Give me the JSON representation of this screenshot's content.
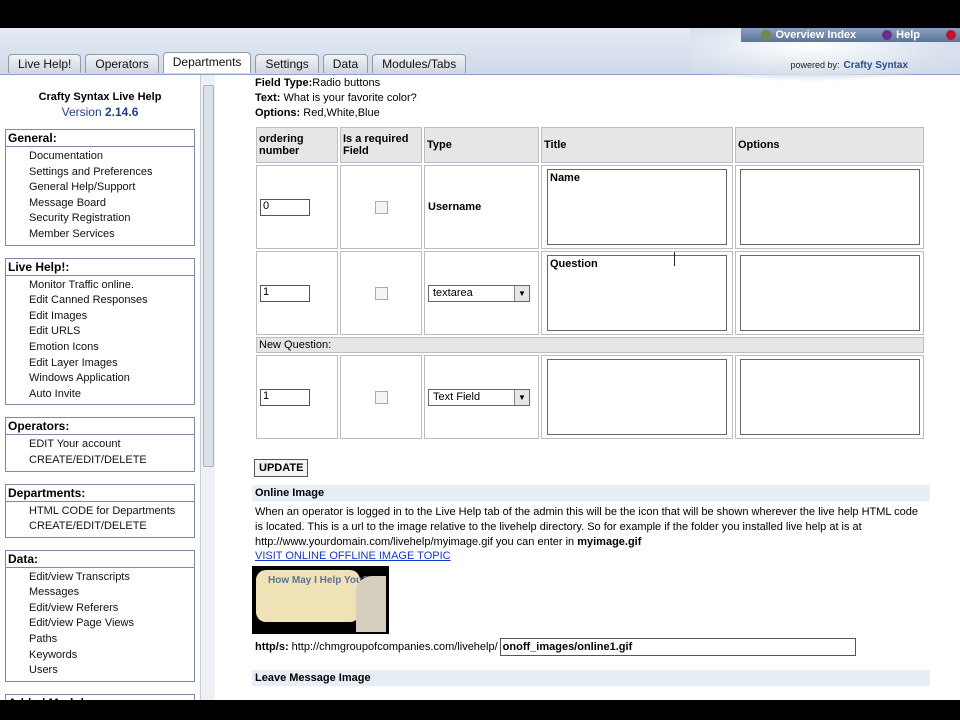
{
  "header": {
    "links": [
      {
        "label": "Overview Index",
        "icon": "overview-icon",
        "color": "#6f8a4a"
      },
      {
        "label": "Help",
        "icon": "help-icon",
        "color": "#6a2e8f"
      },
      {
        "label": "",
        "icon": "close-icon",
        "color": "#c8102e"
      }
    ],
    "powered_by": "powered by:",
    "brand": "Crafty Syntax"
  },
  "tabs": [
    "Live Help!",
    "Operators",
    "Departments",
    "Settings",
    "Data",
    "Modules/Tabs"
  ],
  "active_tab": "Departments",
  "sidebar": {
    "title": "Crafty Syntax Live Help",
    "version_prefix": "Version",
    "version": "2.14.6",
    "groups": [
      {
        "title": "General:",
        "items": [
          "Documentation",
          "Settings and Preferences",
          "General Help/Support",
          "Message Board",
          "Security Registration",
          "Member Services"
        ]
      },
      {
        "title": "Live Help!:",
        "items": [
          "Monitor Traffic online.",
          "Edit Canned Responses",
          "Edit Images",
          "Edit URLS",
          "Emotion Icons",
          "Edit Layer Images",
          "Windows Application",
          "Auto Invite"
        ]
      },
      {
        "title": "Operators:",
        "items": [
          "EDIT Your account",
          "CREATE/EDIT/DELETE"
        ]
      },
      {
        "title": "Departments:",
        "items": [
          "HTML CODE for Departments",
          "CREATE/EDIT/DELETE"
        ]
      },
      {
        "title": "Data:",
        "items": [
          "Edit/view Transcripts",
          "Messages",
          "Edit/view Referers",
          "Edit/view Page Views",
          "Paths",
          "Keywords",
          "Users"
        ]
      },
      {
        "title": "Added Modules :",
        "items": []
      }
    ]
  },
  "main": {
    "field_type_label": "Field Type:",
    "field_type_value": "Radio buttons",
    "text_label": "Text:",
    "text_value": "What is your favorite color?",
    "options_label": "Options:",
    "options_value": "Red,White,Blue",
    "columns": [
      "ordering number",
      "Is a required Field",
      "Type",
      "Title",
      "Options"
    ],
    "rows": [
      {
        "ordering": "0",
        "type": "Username",
        "title": "Name",
        "options": ""
      },
      {
        "ordering": "1",
        "type": "textarea",
        "title": "Question",
        "options": ""
      }
    ],
    "new_question_label": "New Question:",
    "new_row": {
      "ordering": "1",
      "type": "Text Field",
      "title": "",
      "options": ""
    },
    "update_label": "UPDATE",
    "online_image_heading": "Online Image",
    "online_image_text_1": "When an operator is logged in to the Live Help tab of the admin this will be the icon that will be shown wherever the live help HTML code is located. This is a url to the image relative to the livehelp directory. So for example if the folder you installed live help at is at http://www.yourdomain.com/livehelp/myimage.gif you can enter in ",
    "online_image_text_bold": "myimage.gif",
    "online_image_link": "VISIT ONLINE OFFLINE IMAGE TOPIC",
    "online_image_caption": "How May I Help You?",
    "http_label": "http/s:",
    "http_base": "http://chmgroupofcompanies.com/livehelp/",
    "http_value": "onoff_images/online1.gif",
    "leave_message_heading": "Leave Message Image"
  }
}
